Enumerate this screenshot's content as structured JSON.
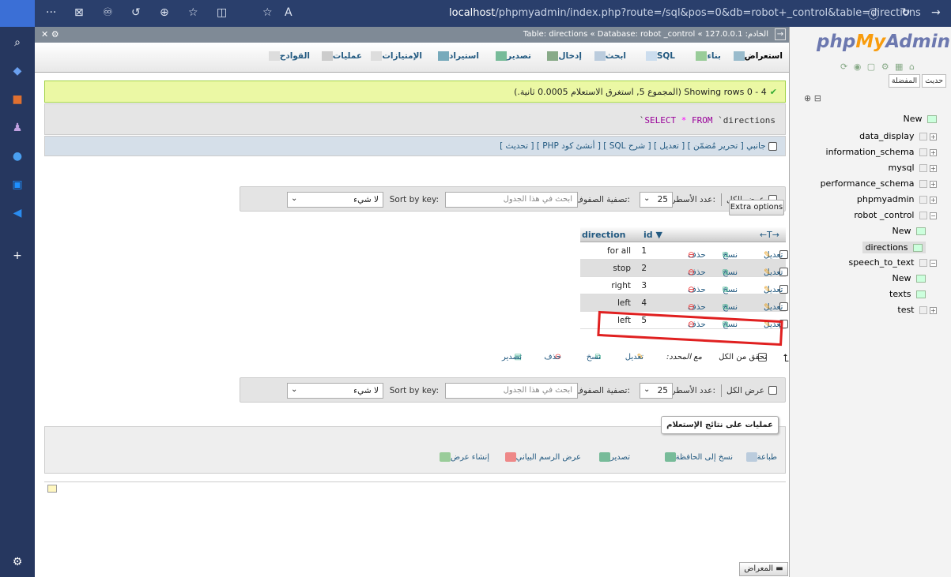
{
  "browser": {
    "url_host": "localhost",
    "url_rest": "/phpmyadmin/index.php?route=/sql&pos=0&db=robot+_control&table=directions"
  },
  "header": {
    "breadcrumb": "Table: directions « Database: robot _control « 127.0.0.1 :الخادم"
  },
  "tabs": [
    {
      "label": "استعراض",
      "active": true
    },
    {
      "label": "بناء"
    },
    {
      "label": "SQL"
    },
    {
      "label": "ابحث"
    },
    {
      "label": "إدخال"
    },
    {
      "label": "تصدير"
    },
    {
      "label": "استيراد"
    },
    {
      "label": "الإمتيازات"
    },
    {
      "label": "عمليات"
    },
    {
      "label": "القوادح"
    }
  ],
  "success": {
    "text": "Showing rows 0 - 4 (المجموع 5, استغرق الاستعلام 0.0005 ثانية.)"
  },
  "sql": {
    "select": "SELECT",
    "star": "*",
    "from": "FROM",
    "table": "`directions",
    "prefix": "`"
  },
  "sql_links": {
    "text": "جانبي [ تحرير مُضمّن ] [ تعديل ] [ شرح SQL ] [ أنشئ كود PHP ] [ تحديث ]"
  },
  "nav": {
    "show_all": "عرض الكل",
    "rows_label": "عدد الأسطر:",
    "rows_value": "25",
    "filter_label": "تصفية الصفوف:",
    "search_placeholder": "ابحث في هذا الجدول",
    "sort_label": "Sort by key:",
    "sort_value": "لا شيء"
  },
  "extra_options": "Extra options",
  "table": {
    "headers": {
      "id": "id ▼",
      "direction": "direction",
      "arrows": "←T→"
    },
    "rows": [
      {
        "id": "1",
        "direction": "for all"
      },
      {
        "id": "2",
        "direction": "stop"
      },
      {
        "id": "3",
        "direction": "right"
      },
      {
        "id": "4",
        "direction": "left"
      },
      {
        "id": "5",
        "direction": "left"
      }
    ],
    "actions": {
      "edit": "تعديل",
      "copy": "نسخ",
      "delete": "حذف"
    }
  },
  "with_selected": {
    "check_all": "تحقق من الكل",
    "label": "مع المحدد:",
    "edit": "تعديل",
    "copy": "نسخ",
    "delete": "حذف",
    "export": "تصدير"
  },
  "query_ops": {
    "legend": "عمليات على نتائج الإستعلام",
    "print": "طباعة",
    "copy_clipboard": "نسخ إلى الحافظة",
    "export": "تصدير",
    "chart": "عرض الرسم البياني",
    "create_view": "إنشاء عرض"
  },
  "console": "المعراض",
  "nav_panel": {
    "logo_php": "php",
    "logo_my": "My",
    "logo_admin": "Admin",
    "tab_recent": "حديث",
    "tab_fav": "المفضلة",
    "tree": [
      {
        "label": "New"
      },
      {
        "label": "data_display"
      },
      {
        "label": "information_schema"
      },
      {
        "label": "mysql"
      },
      {
        "label": "performance_schema"
      },
      {
        "label": "phpmyadmin"
      },
      {
        "label": "robot _control"
      },
      {
        "label": "New"
      },
      {
        "label": "directions"
      },
      {
        "label": "speech_to_text"
      },
      {
        "label": "New"
      },
      {
        "label": "texts"
      },
      {
        "label": "test"
      }
    ]
  }
}
